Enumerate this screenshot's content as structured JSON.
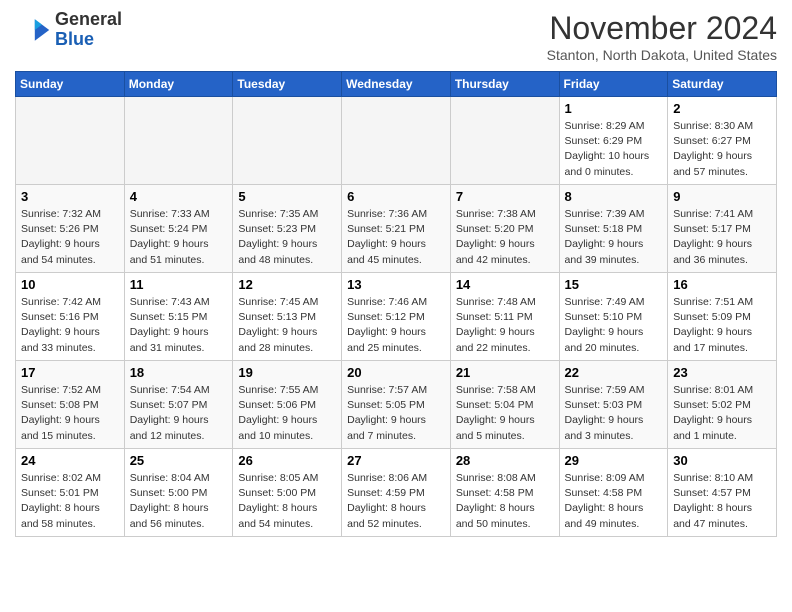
{
  "header": {
    "logo_line1": "General",
    "logo_line2": "Blue",
    "month": "November 2024",
    "location": "Stanton, North Dakota, United States"
  },
  "weekdays": [
    "Sunday",
    "Monday",
    "Tuesday",
    "Wednesday",
    "Thursday",
    "Friday",
    "Saturday"
  ],
  "weeks": [
    [
      {
        "day": "",
        "info": ""
      },
      {
        "day": "",
        "info": ""
      },
      {
        "day": "",
        "info": ""
      },
      {
        "day": "",
        "info": ""
      },
      {
        "day": "",
        "info": ""
      },
      {
        "day": "1",
        "info": "Sunrise: 8:29 AM\nSunset: 6:29 PM\nDaylight: 10 hours\nand 0 minutes."
      },
      {
        "day": "2",
        "info": "Sunrise: 8:30 AM\nSunset: 6:27 PM\nDaylight: 9 hours\nand 57 minutes."
      }
    ],
    [
      {
        "day": "3",
        "info": "Sunrise: 7:32 AM\nSunset: 5:26 PM\nDaylight: 9 hours\nand 54 minutes."
      },
      {
        "day": "4",
        "info": "Sunrise: 7:33 AM\nSunset: 5:24 PM\nDaylight: 9 hours\nand 51 minutes."
      },
      {
        "day": "5",
        "info": "Sunrise: 7:35 AM\nSunset: 5:23 PM\nDaylight: 9 hours\nand 48 minutes."
      },
      {
        "day": "6",
        "info": "Sunrise: 7:36 AM\nSunset: 5:21 PM\nDaylight: 9 hours\nand 45 minutes."
      },
      {
        "day": "7",
        "info": "Sunrise: 7:38 AM\nSunset: 5:20 PM\nDaylight: 9 hours\nand 42 minutes."
      },
      {
        "day": "8",
        "info": "Sunrise: 7:39 AM\nSunset: 5:18 PM\nDaylight: 9 hours\nand 39 minutes."
      },
      {
        "day": "9",
        "info": "Sunrise: 7:41 AM\nSunset: 5:17 PM\nDaylight: 9 hours\nand 36 minutes."
      }
    ],
    [
      {
        "day": "10",
        "info": "Sunrise: 7:42 AM\nSunset: 5:16 PM\nDaylight: 9 hours\nand 33 minutes."
      },
      {
        "day": "11",
        "info": "Sunrise: 7:43 AM\nSunset: 5:15 PM\nDaylight: 9 hours\nand 31 minutes."
      },
      {
        "day": "12",
        "info": "Sunrise: 7:45 AM\nSunset: 5:13 PM\nDaylight: 9 hours\nand 28 minutes."
      },
      {
        "day": "13",
        "info": "Sunrise: 7:46 AM\nSunset: 5:12 PM\nDaylight: 9 hours\nand 25 minutes."
      },
      {
        "day": "14",
        "info": "Sunrise: 7:48 AM\nSunset: 5:11 PM\nDaylight: 9 hours\nand 22 minutes."
      },
      {
        "day": "15",
        "info": "Sunrise: 7:49 AM\nSunset: 5:10 PM\nDaylight: 9 hours\nand 20 minutes."
      },
      {
        "day": "16",
        "info": "Sunrise: 7:51 AM\nSunset: 5:09 PM\nDaylight: 9 hours\nand 17 minutes."
      }
    ],
    [
      {
        "day": "17",
        "info": "Sunrise: 7:52 AM\nSunset: 5:08 PM\nDaylight: 9 hours\nand 15 minutes."
      },
      {
        "day": "18",
        "info": "Sunrise: 7:54 AM\nSunset: 5:07 PM\nDaylight: 9 hours\nand 12 minutes."
      },
      {
        "day": "19",
        "info": "Sunrise: 7:55 AM\nSunset: 5:06 PM\nDaylight: 9 hours\nand 10 minutes."
      },
      {
        "day": "20",
        "info": "Sunrise: 7:57 AM\nSunset: 5:05 PM\nDaylight: 9 hours\nand 7 minutes."
      },
      {
        "day": "21",
        "info": "Sunrise: 7:58 AM\nSunset: 5:04 PM\nDaylight: 9 hours\nand 5 minutes."
      },
      {
        "day": "22",
        "info": "Sunrise: 7:59 AM\nSunset: 5:03 PM\nDaylight: 9 hours\nand 3 minutes."
      },
      {
        "day": "23",
        "info": "Sunrise: 8:01 AM\nSunset: 5:02 PM\nDaylight: 9 hours\nand 1 minute."
      }
    ],
    [
      {
        "day": "24",
        "info": "Sunrise: 8:02 AM\nSunset: 5:01 PM\nDaylight: 8 hours\nand 58 minutes."
      },
      {
        "day": "25",
        "info": "Sunrise: 8:04 AM\nSunset: 5:00 PM\nDaylight: 8 hours\nand 56 minutes."
      },
      {
        "day": "26",
        "info": "Sunrise: 8:05 AM\nSunset: 5:00 PM\nDaylight: 8 hours\nand 54 minutes."
      },
      {
        "day": "27",
        "info": "Sunrise: 8:06 AM\nSunset: 4:59 PM\nDaylight: 8 hours\nand 52 minutes."
      },
      {
        "day": "28",
        "info": "Sunrise: 8:08 AM\nSunset: 4:58 PM\nDaylight: 8 hours\nand 50 minutes."
      },
      {
        "day": "29",
        "info": "Sunrise: 8:09 AM\nSunset: 4:58 PM\nDaylight: 8 hours\nand 49 minutes."
      },
      {
        "day": "30",
        "info": "Sunrise: 8:10 AM\nSunset: 4:57 PM\nDaylight: 8 hours\nand 47 minutes."
      }
    ]
  ]
}
